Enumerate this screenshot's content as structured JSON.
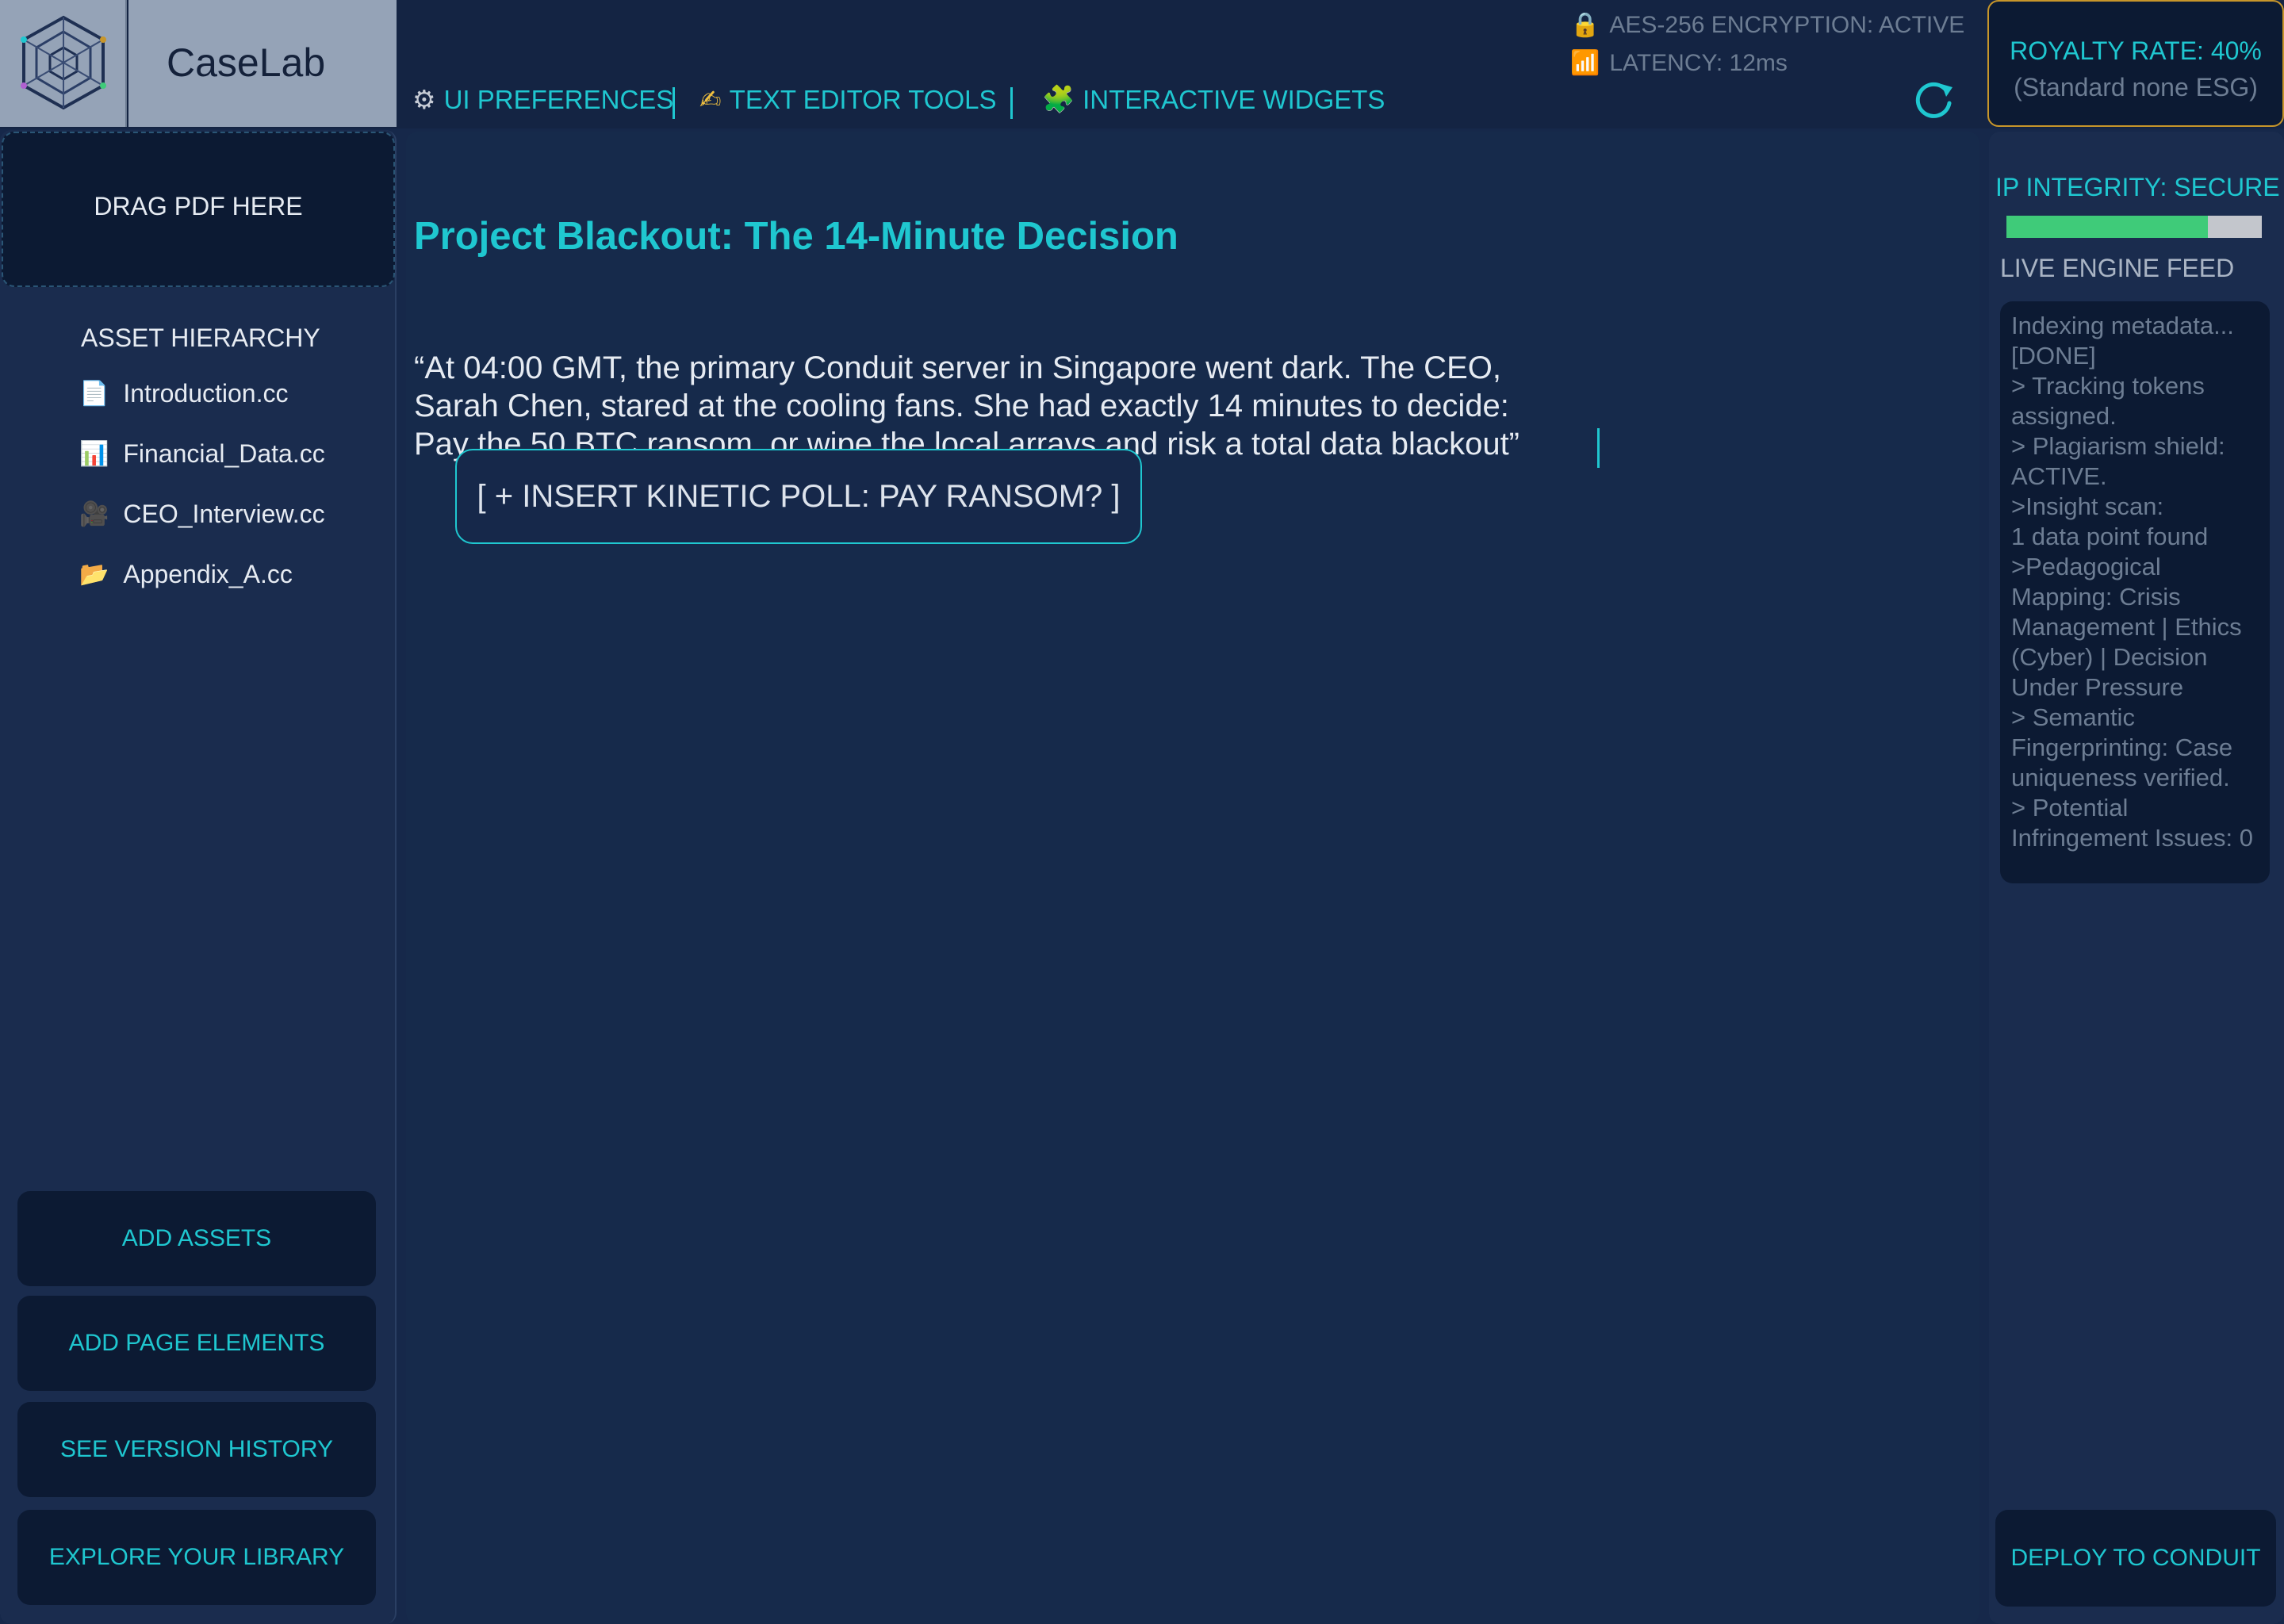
{
  "app": {
    "name": "CaseLab"
  },
  "toolbar": {
    "tabs": [
      {
        "icon": "gear-icon",
        "glyph": "⚙",
        "label": "UI PREFERENCES"
      },
      {
        "icon": "writing-hand-icon",
        "glyph": "✍",
        "label": "TEXT EDITOR TOOLS"
      },
      {
        "icon": "puzzle-icon",
        "glyph": "🧩",
        "label": "INTERACTIVE WIDGETS"
      }
    ]
  },
  "status": {
    "encryption": "AES-256 ENCRYPTION: ACTIVE",
    "latency": "LATENCY: 12ms"
  },
  "royalty": {
    "rate": "ROYALTY RATE: 40%",
    "note": "(Standard none ESG)"
  },
  "sidebar": {
    "dropzone": "DRAG PDF HERE",
    "asset_heading": "ASSET HIERARCHY",
    "assets": [
      {
        "icon": "document-icon",
        "glyph": "📄",
        "label": "Introduction.cc"
      },
      {
        "icon": "chart-icon",
        "glyph": "📊",
        "label": "Financial_Data.cc"
      },
      {
        "icon": "video-camera-icon",
        "glyph": "🎥",
        "label": "CEO_Interview.cc"
      },
      {
        "icon": "folder-icon",
        "glyph": "📂",
        "label": "Appendix_A.cc"
      }
    ],
    "buttons": [
      {
        "label": "ADD ASSETS"
      },
      {
        "label": "ADD PAGE ELEMENTS"
      },
      {
        "label": "SEE VERSION HISTORY"
      },
      {
        "label": "EXPLORE YOUR LIBRARY"
      }
    ]
  },
  "document": {
    "title": "Project Blackout: The 14-Minute Decision",
    "body": "“At 04:00 GMT, the primary Conduit server in Singapore went dark. The CEO,\nSarah Chen, stared at the cooling fans. She had exactly 14 minutes to decide:\nPay the 50 BTC ransom, or wipe the local arrays and risk a total data blackout”",
    "poll_button": "[ + INSERT KINETIC POLL: PAY RANSOM? ]"
  },
  "right_panel": {
    "ip_integrity": "IP INTEGRITY: SECURE",
    "ip_integrity_level": 0.79,
    "feed_label": "LIVE ENGINE FEED",
    "feed_text": " Indexing metadata...\n[DONE]\n> Tracking tokens assigned.\n> Plagiarism shield: ACTIVE.\n>Insight scan:\n1 data point found\n>Pedagogical Mapping: Crisis Management | Ethics (Cyber) | Decision Under Pressure\n> Semantic Fingerprinting: Case uniqueness verified.\n> Potential Infringement Issues: 0",
    "deploy_button": "DEPLOY TO CONDUIT"
  },
  "colors": {
    "accent": "#1fc7d0",
    "background": "#16284a",
    "panel": "#0c1a33",
    "royalty_border": "#c8962a",
    "integrity_fill": "#3fcb79"
  }
}
